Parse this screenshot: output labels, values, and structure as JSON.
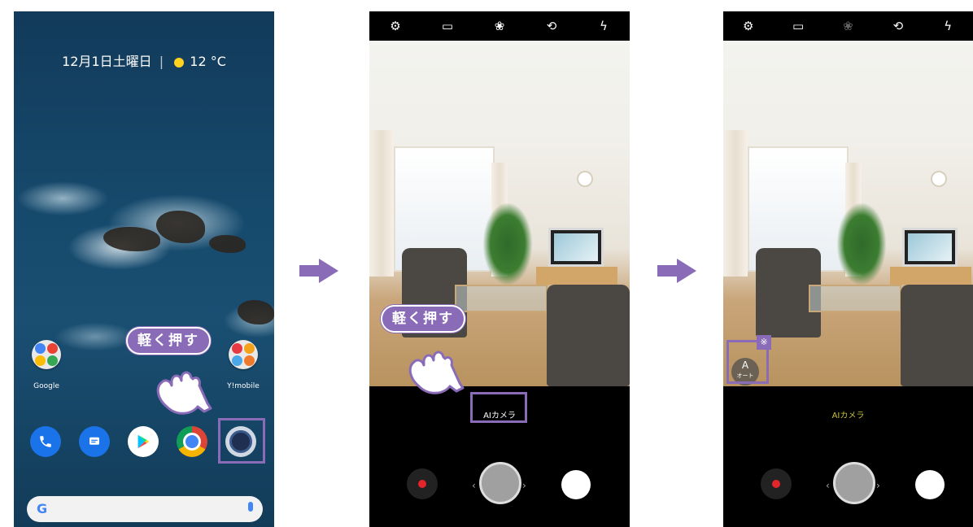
{
  "home": {
    "date_weather": "12月1日土曜日",
    "temperature": "12 °C",
    "folder_left_label": "Google",
    "folder_right_label": "Y!mobile",
    "dock_icons": [
      "phone-icon",
      "messages-icon",
      "play-store-icon",
      "chrome-icon",
      "camera-icon"
    ],
    "search_icon": "google-g-icon",
    "mic_icon": "mic-icon"
  },
  "callout_text": "軽く押す",
  "camera": {
    "top_icons": [
      "settings-icon",
      "aspect-ratio-icon",
      "filter-icon",
      "switch-camera-icon",
      "flash-off-icon"
    ],
    "mode_label": "AIカメラ",
    "ai_badge_letter": "A",
    "ai_badge_sublabel": "オート",
    "note_mark": "※"
  },
  "colors": {
    "accent": "#8a6bb8",
    "record": "#e4262c",
    "mode_active": "#c9c23a"
  }
}
